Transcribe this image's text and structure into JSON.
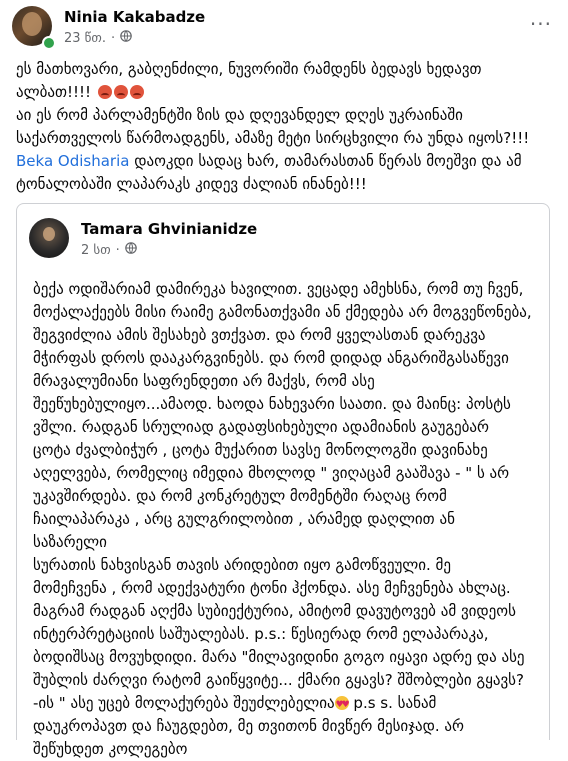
{
  "post": {
    "author": "Ninia Kakabadze",
    "time": "23 წთ.",
    "dot": "·",
    "more": "···",
    "text_lines": [
      "ეს მათხოვარი, გაბღენძილი, ნუვორიში რამდენს ბედავს ხედავთ",
      "ალბათ!!!!",
      "აი ეს რომ პარლამენტში ზის და დღევანდელ დღეს უკრაინაში",
      "საქართველოს წარმოადგენს, ამაზე მეტი სირცხვილი რა უნდა იყოს?!!!"
    ],
    "mention": "Beka Odisharia",
    "mention_rest": " დაოკდი სადაც ხარ, თამარასთან წერას მოეშვი და ამ",
    "last_line": "ტონალობაში ლაპარაკს კიდევ ძალიან ინანებ!!!"
  },
  "shared": {
    "author": "Tamara Ghvinianidze",
    "time": "2 სთ",
    "dot": "·",
    "lines": [
      "ბექა ოდიშარიამ დამირეკა ხავილით. ვეცადე ამეხსნა, რომ თუ ჩვენ,",
      "მოქალაქეებს მისი რაიმე გამონათქვამი ან ქმედება არ მოგვეწონება,",
      "შეგვიძლია ამის შესახებ ვთქვათ.  და რომ ყველასთან დარეკვა",
      "მჭირფას დროს დააკარგვინებს. და რომ დიდად ანგარიშგასაწევი",
      "მრავალუმიანი საფრენდეთი არ მაქვს, რომ ასე",
      "შეეწუხებულიყო...ამაოდ. ხაოდა  ნახევარი საათი.  და მაინც: პოსტს",
      "ვშლი. რადგან  სრულიად გადაფსიხებული  ადამიანის  გაუგებარ",
      "ცოტა ძვალბიჭურ , ცოტა მუქარით სავსე მონოლოგში დავინახე",
      "აღელვება, რომელიც იმედია მხოლოდ \" ვიღაცამ გააშავა - \"  ს არ",
      "უკავშირდება.  და რომ კონკრეტულ  მომენტში რაღაც  რომ",
      "ჩაილაპარაკა , არც გულგრილობით , არამედ დაღლით ან საზარელი",
      "სურათის ნახვისგან თავის არიდებით იყო გამოწვეული. მე",
      "მომეჩვენა , რომ ადექვატური ტონი ჰქონდა. ასე მეჩვენება ახლაც.",
      "მაგრამ რადგან აღქმა სუბიექტურია, ამიტომ დავუტოვებ ამ ვიდეოს",
      "ინტერპრეტაციის  საშუალებას.  p.s.: წესიერად რომ ელაპარაკა,",
      "ბოდიშსაც მოვუხდიდი. მარა \"მილავიდინი გოგო იყავი  ადრე და ასე",
      "შუბლის ძარღვი რატომ გაიწყვიტე...  ქმარი გყავს? შშობლები გყავს?",
      "-ის \" ასე უცებ მოლაქურება შეუძლებელია",
      "დაუკროპავთ  და ჩაუგდებთ, მე თვითონ მივწერ მესიჯად. არ",
      "შეწუხდეთ კოლეგებო"
    ],
    "love_tail": " p.s s. სანამ"
  },
  "icons": {
    "globe": "globe-icon",
    "angry": "angry-emoji-icon",
    "love": "heart-eyes-emoji-icon"
  },
  "colors": {
    "mention": "#216fdb",
    "online": "#31a24c",
    "meta": "#65676b"
  }
}
